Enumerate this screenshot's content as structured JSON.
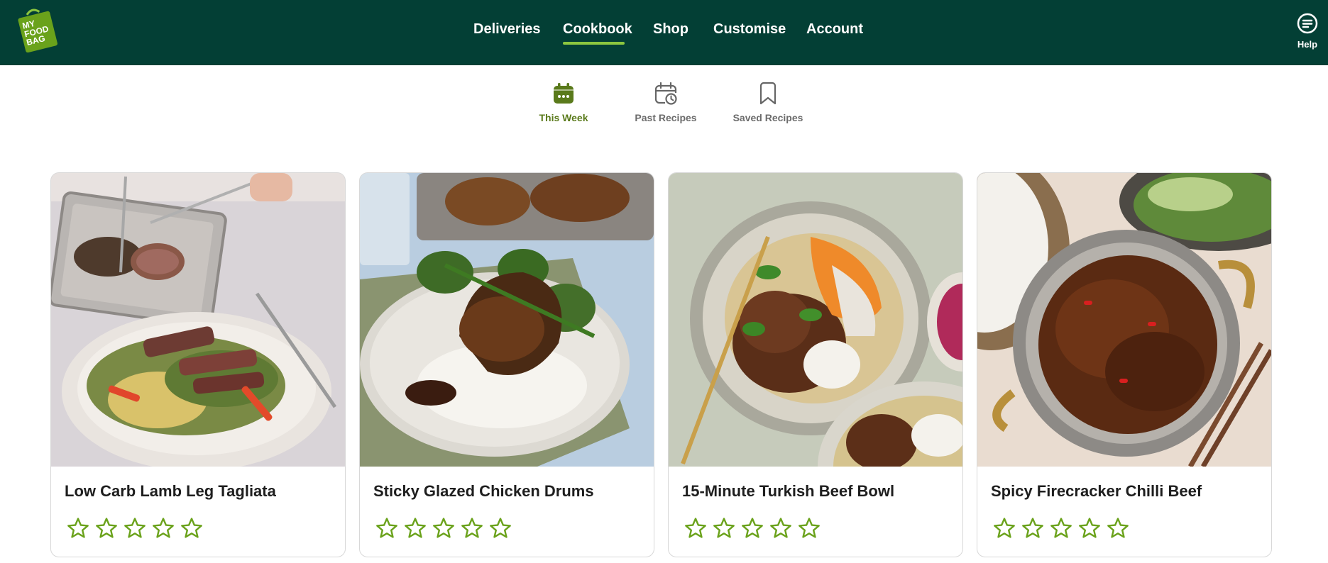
{
  "header": {
    "logo_text": [
      "MY",
      "FOOD",
      "BAG"
    ],
    "nav": [
      {
        "label": "Deliveries"
      },
      {
        "label": "Cookbook",
        "active": true
      },
      {
        "label": "Shop"
      },
      {
        "label": "Customise"
      },
      {
        "label": "Account"
      }
    ],
    "help_label": "Help",
    "help_icon": "help-lines-icon"
  },
  "subnav": [
    {
      "label": "This Week",
      "icon": "calendar-dots-icon",
      "active": true
    },
    {
      "label": "Past Recipes",
      "icon": "calendar-clock-icon"
    },
    {
      "label": "Saved Recipes",
      "icon": "bookmark-icon"
    }
  ],
  "recipes": [
    {
      "title": "Low Carb Lamb Leg Tagliata",
      "rating": 0,
      "max_rating": 5,
      "photo": "lamb-salad-photo"
    },
    {
      "title": "Sticky Glazed Chicken Drums",
      "rating": 0,
      "max_rating": 5,
      "photo": "chicken-rice-photo"
    },
    {
      "title": "15-Minute Turkish Beef Bowl",
      "rating": 0,
      "max_rating": 5,
      "photo": "beef-bowl-photo"
    },
    {
      "title": "Spicy Firecracker Chilli Beef",
      "rating": 0,
      "max_rating": 5,
      "photo": "chilli-beef-pan-photo"
    }
  ],
  "colors": {
    "header_bg": "#033f35",
    "accent_green": "#8cc63f",
    "star_outline": "#6aa21b",
    "active_subnav": "#5a7a1b"
  }
}
